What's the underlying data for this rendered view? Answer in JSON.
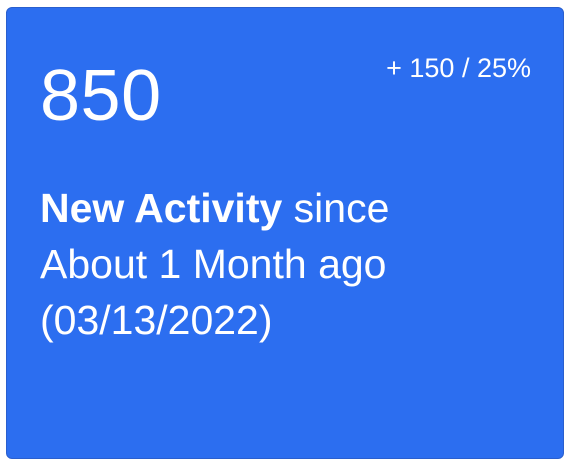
{
  "card": {
    "background_color": "#2c6ef0",
    "text_color": "#ffffff",
    "value": "850",
    "delta": "+ 150 / 25%",
    "description": {
      "strong": "New Activity",
      "line1_rest": " since",
      "line2": "About 1 Month ago",
      "line3": "(03/13/2022)"
    }
  }
}
